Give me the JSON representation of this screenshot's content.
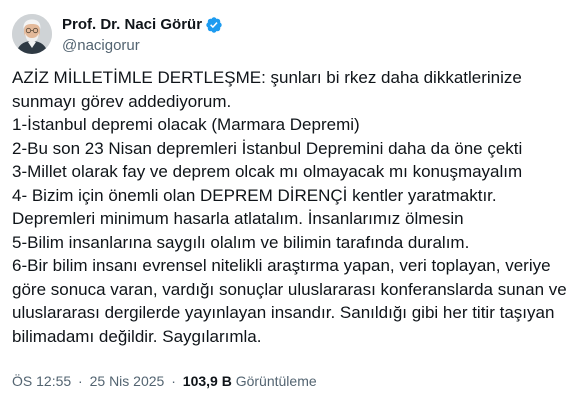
{
  "author": {
    "display_name": "Prof. Dr. Naci Görür",
    "handle": "@nacigorur",
    "verified": true,
    "avatar_icon": "profile-photo",
    "colors": {
      "verified_badge": "#1d9bf0",
      "handle_text": "#536471"
    }
  },
  "tweet": {
    "lines": [
      "AZİZ MİLLETİMLE DERTLEŞME: şunları bi rkez daha dikkatlerinize",
      "sunmayı görev addediyorum.",
      "1-İstanbul depremi olacak (Marmara Depremi)",
      "2-Bu son 23 Nisan depremleri İstanbul Depremini daha da öne çekti",
      "3-Millet olarak fay ve deprem olcak mı olmayacak mı konuşmayalım",
      "4- Bizim için önemli olan DEPREM DİRENÇİ kentler yaratmaktır.",
      "Depremleri minimum hasarla atlatalım. İnsanlarımız ölmesin",
      "5-Bilim insanlarına saygılı olalım ve bilimin tarafında duralım.",
      "6-Bir bilim insanı evrensel nitelikli araştırma yapan, veri toplayan, veriye",
      "göre sonuca varan, vardığı sonuçlar uluslararası konferanslarda sunan ve",
      "uluslararası dergilerde yayınlayan insandır. Sanıldığı gibi her titir taşıyan",
      "bilimadamı değildir. Saygılarımla."
    ]
  },
  "meta": {
    "time": "ÖS 12:55",
    "separator": "·",
    "date": "25 Nis 2025",
    "views_count": "103,9 B",
    "views_label": "Görüntüleme"
  }
}
